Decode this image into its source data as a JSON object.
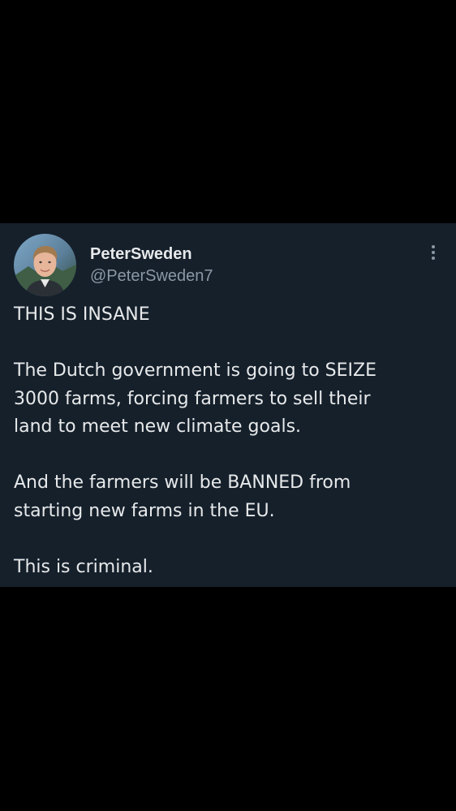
{
  "colors": {
    "page_background": "#000000",
    "card_background": "#15202b",
    "primary_text": "#e7e9ea",
    "secondary_text": "#8b98a5"
  },
  "tweet": {
    "author": {
      "display_name": "PeterSweden",
      "handle": "@PeterSweden7",
      "avatar_icon": "profile-photo"
    },
    "more_icon": "vertical-ellipsis-icon",
    "paragraphs": [
      "THIS IS INSANE",
      "The Dutch government is going to SEIZE\n3000 farms, forcing farmers to sell their\nland to meet new climate goals.",
      "And the farmers will be BANNED from\nstarting new farms in the EU.",
      "This is criminal."
    ]
  }
}
